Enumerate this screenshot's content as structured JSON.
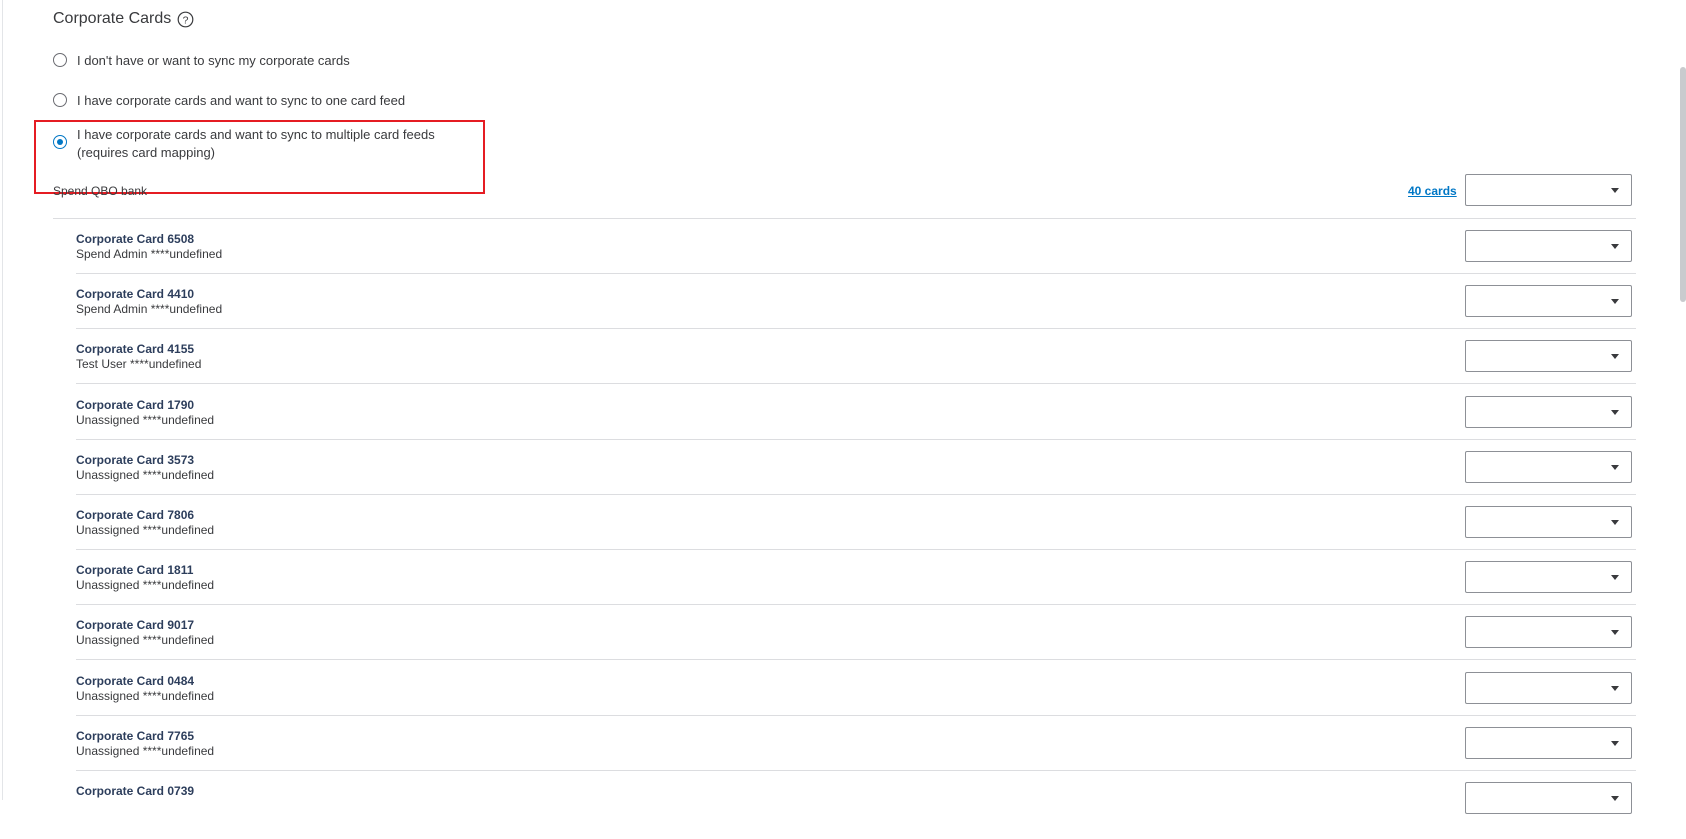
{
  "section": {
    "title": "Corporate Cards",
    "help_icon": "question-circle-icon"
  },
  "sync_options": [
    {
      "lines": [
        "I don't have or want to sync my corporate cards"
      ],
      "selected": false
    },
    {
      "lines": [
        "I have corporate cards and want to sync to one card feed"
      ],
      "selected": false
    },
    {
      "lines": [
        "I have corporate cards and want to sync to multiple card feeds",
        "(requires card mapping)"
      ],
      "selected": true
    }
  ],
  "bank": {
    "label": "Spend QBO bank",
    "cards_link": "40 cards",
    "selected_value": ""
  },
  "cards": [
    {
      "name": "Corporate Card 6508",
      "owner": "Spend Admin ****undefined",
      "mapping": ""
    },
    {
      "name": "Corporate Card 4410",
      "owner": "Spend Admin ****undefined",
      "mapping": ""
    },
    {
      "name": "Corporate Card 4155",
      "owner": "Test User ****undefined",
      "mapping": ""
    },
    {
      "name": "Corporate Card 1790",
      "owner": "Unassigned ****undefined",
      "mapping": ""
    },
    {
      "name": "Corporate Card 3573",
      "owner": "Unassigned ****undefined",
      "mapping": ""
    },
    {
      "name": "Corporate Card 7806",
      "owner": "Unassigned ****undefined",
      "mapping": ""
    },
    {
      "name": "Corporate Card 1811",
      "owner": "Unassigned ****undefined",
      "mapping": ""
    },
    {
      "name": "Corporate Card 9017",
      "owner": "Unassigned ****undefined",
      "mapping": ""
    },
    {
      "name": "Corporate Card 0484",
      "owner": "Unassigned ****undefined",
      "mapping": ""
    },
    {
      "name": "Corporate Card 7765",
      "owner": "Unassigned ****undefined",
      "mapping": ""
    },
    {
      "name": "Corporate Card 0739",
      "owner": "",
      "mapping": ""
    }
  ],
  "colors": {
    "accent": "#0077c5",
    "highlight": "#e51c23",
    "card_name": "#2d3e5c"
  }
}
